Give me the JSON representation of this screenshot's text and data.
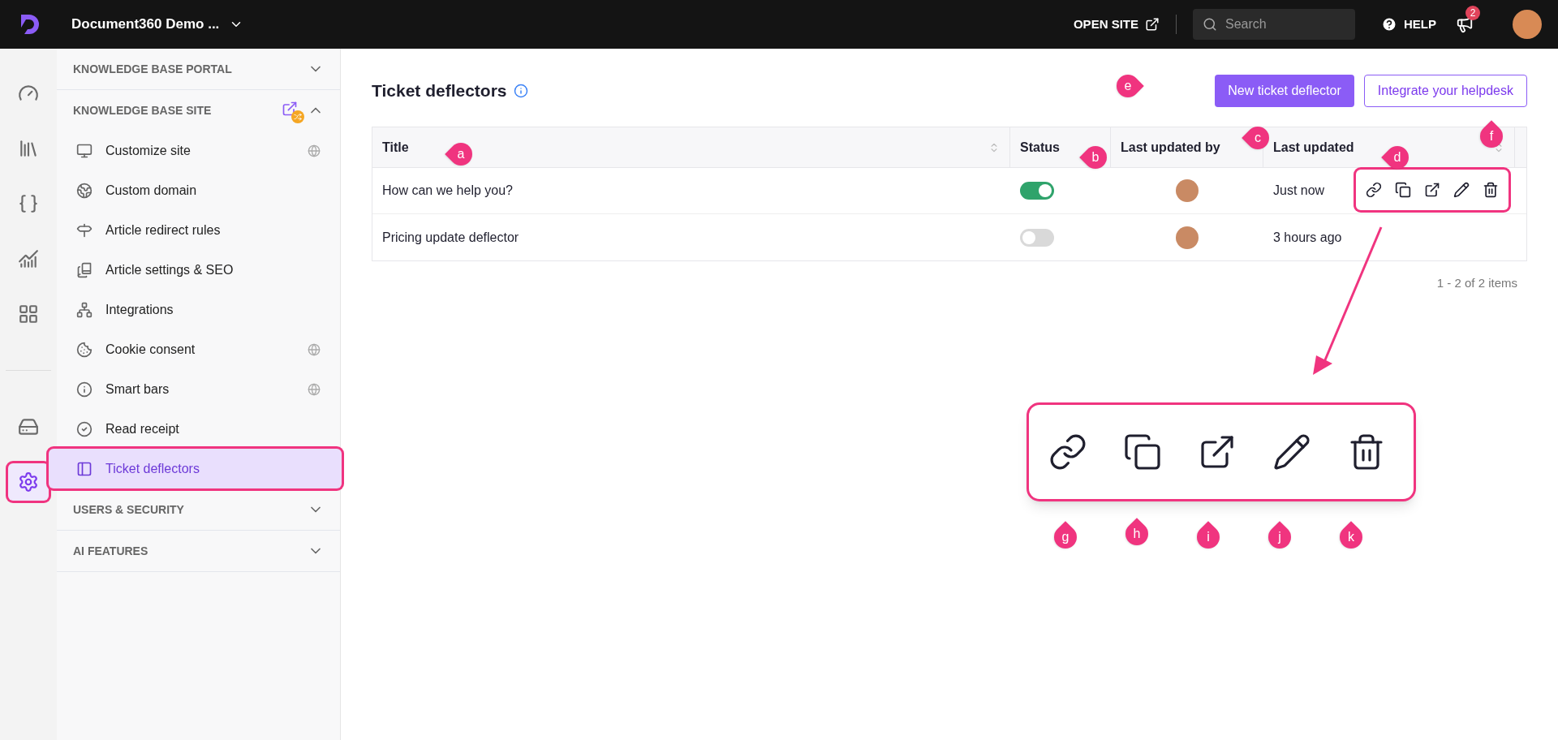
{
  "top_bar": {
    "project": "Document360 Demo ...",
    "open_site": "OPEN SITE",
    "search": {
      "placeholder": "Search"
    },
    "help": "HELP",
    "notifications": "2"
  },
  "rail": [
    {
      "kind": "gauge",
      "selected": false,
      "highlighted": false
    },
    {
      "kind": "library",
      "selected": false,
      "highlighted": false
    },
    {
      "kind": "braces",
      "selected": false,
      "highlighted": false
    },
    {
      "kind": "chart",
      "selected": false,
      "highlighted": false
    },
    {
      "kind": "apps",
      "selected": false,
      "highlighted": false
    },
    {
      "kind": "drive",
      "selected": false,
      "highlighted": false
    },
    {
      "kind": "settings",
      "selected": true,
      "highlighted": true
    }
  ],
  "sidebar": {
    "sections": [
      {
        "title": "KNOWLEDGE BASE PORTAL",
        "expanded": false
      },
      {
        "title": "KNOWLEDGE BASE SITE",
        "expanded": true,
        "items": [
          {
            "label": "Customize site",
            "kind": "monitor",
            "globe": true,
            "selected": false,
            "highlighted": false
          },
          {
            "label": "Custom domain",
            "kind": "earth",
            "globe": false,
            "selected": false,
            "highlighted": false
          },
          {
            "label": "Article redirect rules",
            "kind": "redirect",
            "globe": false,
            "selected": false,
            "highlighted": false
          },
          {
            "label": "Article settings & SEO",
            "kind": "books",
            "globe": false,
            "selected": false,
            "highlighted": false
          },
          {
            "label": "Integrations",
            "kind": "network",
            "globe": false,
            "selected": false,
            "highlighted": false
          },
          {
            "label": "Cookie consent",
            "kind": "cookie",
            "globe": true,
            "selected": false,
            "highlighted": false
          },
          {
            "label": "Smart bars",
            "kind": "info",
            "globe": true,
            "selected": false,
            "highlighted": false
          },
          {
            "label": "Read receipt",
            "kind": "check",
            "globe": false,
            "selected": false,
            "highlighted": false
          },
          {
            "label": "Ticket deflectors",
            "kind": "deflector",
            "globe": false,
            "selected": true,
            "highlighted": true
          }
        ]
      },
      {
        "title": "USERS & SECURITY",
        "expanded": false
      },
      {
        "title": "AI FEATURES",
        "expanded": false
      }
    ]
  },
  "page": {
    "title": "Ticket deflectors",
    "buttons": [
      {
        "label": "New ticket deflector",
        "kind": "primary"
      },
      {
        "label": "Integrate your helpdesk",
        "kind": "outline"
      }
    ]
  },
  "table": {
    "columns": [
      {
        "label": "Title",
        "sortable": true
      },
      {
        "label": "Status",
        "sortable": false
      },
      {
        "label": "Last updated by",
        "sortable": false
      },
      {
        "label": "Last updated",
        "sortable": true
      }
    ],
    "rows": [
      {
        "title": "How can we help you?",
        "on": true,
        "updated": "Just now",
        "hovered": true
      },
      {
        "title": "Pricing update deflector",
        "on": false,
        "updated": "3 hours ago",
        "hovered": false
      }
    ],
    "pagination": "1 - 2 of 2 items"
  },
  "markers": [
    {
      "label": "a"
    },
    {
      "label": "b"
    },
    {
      "label": "c"
    },
    {
      "label": "d"
    },
    {
      "label": "e"
    },
    {
      "label": "f"
    },
    {
      "label": "g"
    },
    {
      "label": "h"
    },
    {
      "label": "i"
    },
    {
      "label": "j"
    },
    {
      "label": "k"
    }
  ]
}
